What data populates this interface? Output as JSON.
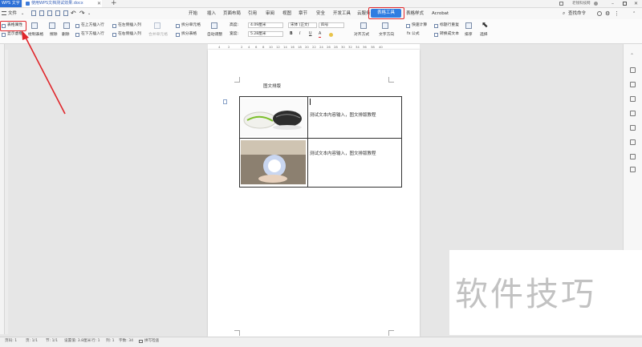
{
  "titlebar": {
    "app_tab": "WPS 文字",
    "doc_tab": "使用WPS文档测试效果.docx",
    "close_glyph": "✕",
    "new_tab_glyph": "+",
    "user_name": "老钱科技网"
  },
  "menu": {
    "file_label": "文件",
    "items": [
      "开始",
      "插入",
      "页面布局",
      "引用",
      "审阅",
      "视图",
      "章节",
      "安全",
      "开发工具",
      "云服务",
      "表格工具",
      "表格样式",
      "Acrobat"
    ],
    "search_label": "查找命令"
  },
  "ribbon": {
    "table_props_label": "表格属性",
    "show_gridlines_label": "显示虚框",
    "draw_table_label": "绘制表格",
    "erase_label": "擦除",
    "delete_label": "删除",
    "insert_above_label": "在上方插入行",
    "insert_below_label": "在下方插入行",
    "insert_left_label": "在左侧插入列",
    "insert_right_label": "在右侧插入列",
    "merge_cells_label": "合并单元格",
    "split_cells_label": "拆分单元格",
    "split_table_label": "拆分表格",
    "autofit_label": "自动调整",
    "height_label": "高度:",
    "height_value": "4.09厘米",
    "width_label": "宽度:",
    "width_value": "5.28厘米",
    "font_name": "宋体 (正文)",
    "font_size": "四号",
    "bold_label": "B",
    "italic_label": "I",
    "underline_label": "U",
    "font_color_label": "A",
    "align_label": "对齐方式",
    "text_direction_label": "文字方向",
    "quick_calc_label": "快速计算",
    "formula_label": "fx 公式",
    "repeat_header_label": "标题行重复",
    "convert_text_label": "转换成文本",
    "sort_label": "排序",
    "select_label": "选择"
  },
  "ruler": {
    "numbers": [
      "4",
      "2",
      "2",
      "4",
      "6",
      "8",
      "10",
      "12",
      "14",
      "16",
      "18",
      "20",
      "22",
      "24",
      "26",
      "28",
      "30",
      "32",
      "34",
      "36",
      "38",
      "40"
    ]
  },
  "document": {
    "heading": "图文排版",
    "row1_text": "测试文本内容输入，图文排版教程",
    "row2_text": "测试文本内容输入，图文排版教程"
  },
  "statusbar": {
    "page_no": "页码: 1",
    "pages": "页: 1/1",
    "section": "节: 1/1",
    "position": "设置值: 3.8厘米",
    "row": "行: 1",
    "column": "列: 1",
    "word_count": "字数: 34",
    "spell_check": "拼写检查"
  },
  "watermark": {
    "text": "软件技巧"
  },
  "colors": {
    "accent": "#2f7de1",
    "highlight_red": "#e0262b",
    "app_tab": "#2c6fd6"
  }
}
